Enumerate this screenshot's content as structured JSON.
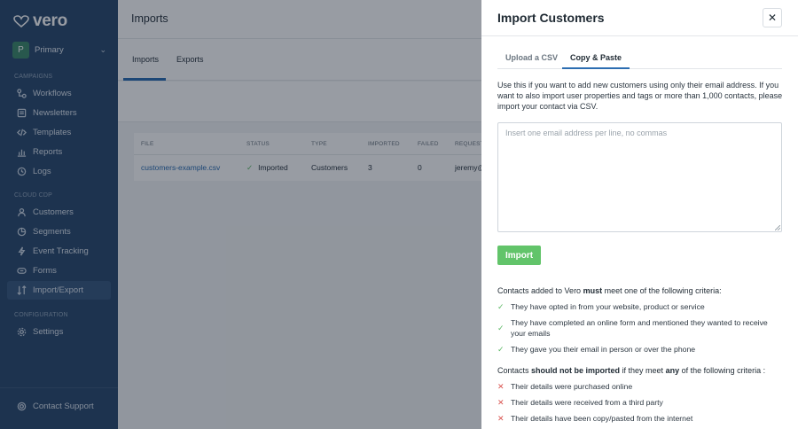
{
  "app": {
    "logo_text": "vero"
  },
  "workspace": {
    "initial": "P",
    "name": "Primary"
  },
  "sidebar": {
    "campaigns_label": "CAMPAIGNS",
    "campaigns": [
      {
        "label": "Workflows",
        "icon": "workflow-icon"
      },
      {
        "label": "Newsletters",
        "icon": "newsletter-icon"
      },
      {
        "label": "Templates",
        "icon": "code-icon"
      },
      {
        "label": "Reports",
        "icon": "chart-icon"
      },
      {
        "label": "Logs",
        "icon": "clock-icon"
      }
    ],
    "cdp_label": "CLOUD CDP",
    "cdp": [
      {
        "label": "Customers",
        "icon": "users-icon"
      },
      {
        "label": "Segments",
        "icon": "pie-icon"
      },
      {
        "label": "Event Tracking",
        "icon": "bolt-icon"
      },
      {
        "label": "Forms",
        "icon": "form-icon"
      },
      {
        "label": "Import/Export",
        "icon": "import-export-icon",
        "active": true
      }
    ],
    "config_label": "CONFIGURATION",
    "settings": {
      "label": "Settings",
      "icon": "gear-icon"
    },
    "support": {
      "label": "Contact Support",
      "icon": "support-icon"
    }
  },
  "main": {
    "title": "Imports",
    "tabs": [
      "Imports",
      "Exports"
    ],
    "table": {
      "headers": [
        "FILE",
        "STATUS",
        "TYPE",
        "IMPORTED",
        "FAILED",
        "REQUEST"
      ],
      "rows": [
        {
          "file": "customers-example.csv",
          "status": "Imported",
          "type": "Customers",
          "imported": "3",
          "failed": "0",
          "requested": "jeremy@"
        }
      ]
    }
  },
  "modal": {
    "title": "Import Customers",
    "close": "✕",
    "tabs": [
      "Upload a CSV",
      "Copy & Paste"
    ],
    "active_tab": 1,
    "description": "Use this if you want to add new customers using only their email address. If you want to also import user properties and tags or more than 1,000 contacts, please import your contact via CSV.",
    "textarea_placeholder": "Insert one email address per line, no commas",
    "textarea_value": "",
    "import_button": "Import",
    "must_heading": {
      "a": "Contacts added to Vero ",
      "b": "must",
      "c": " meet one of the following criteria:"
    },
    "must_items": [
      "They have opted in from your website, product or service",
      "They have completed an online form and mentioned they wanted to receive your emails",
      "They gave you their email in person or over the phone"
    ],
    "not_heading": {
      "a": "Contacts ",
      "b": "should not be imported",
      "c": " if they meet ",
      "d": "any",
      "e": " of the following criteria :"
    },
    "not_items": [
      "Their details were purchased online",
      "Their details were received from a third party",
      "Their details have been copy/pasted from the internet"
    ]
  },
  "colors": {
    "sidebar": "#2c4a6e",
    "accent": "#2c6db1",
    "success": "#62c46a",
    "danger": "#d9534f"
  }
}
